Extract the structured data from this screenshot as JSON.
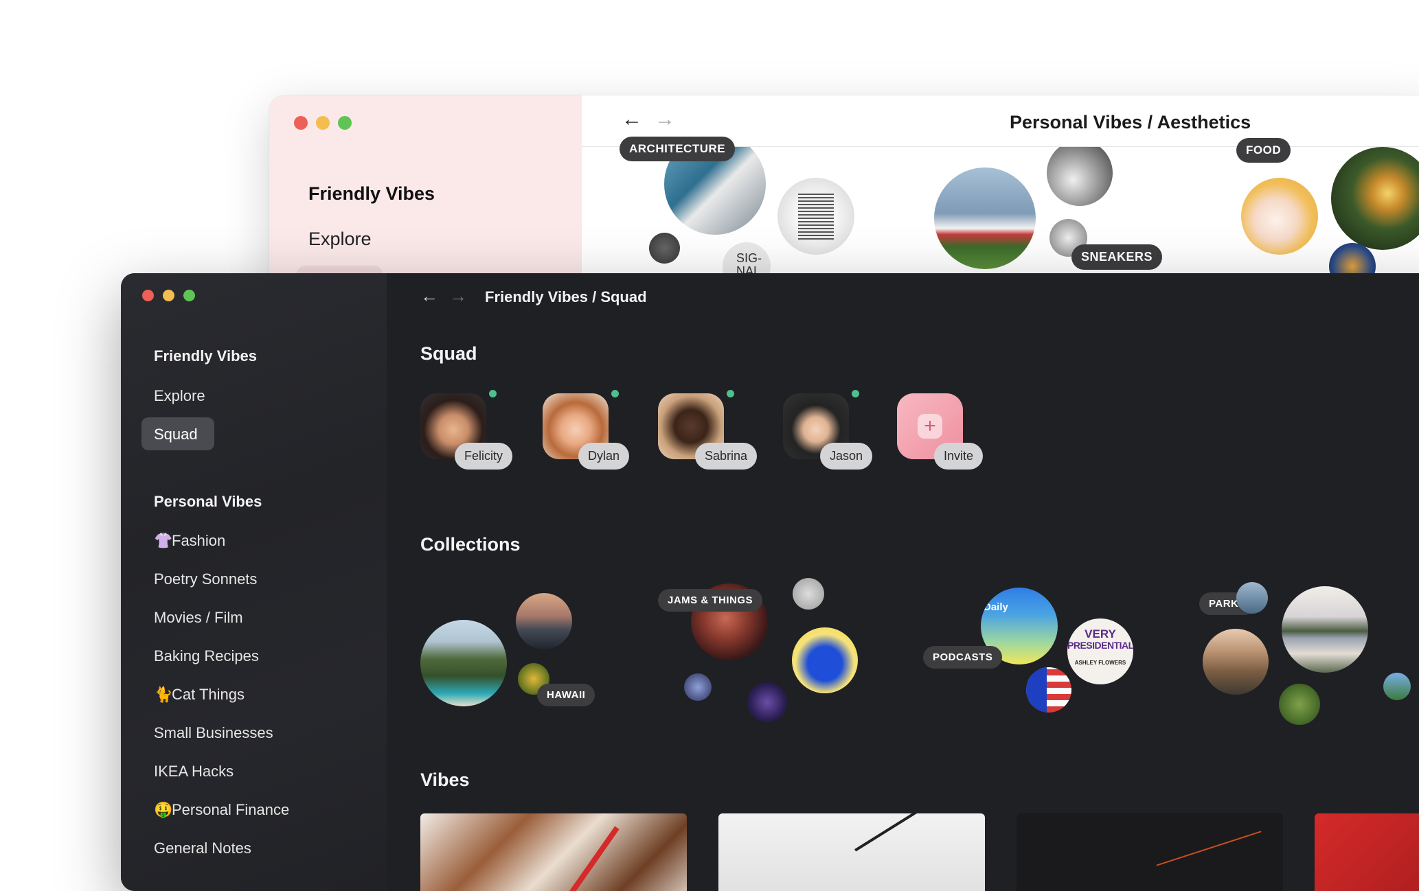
{
  "back_window": {
    "sidebar": {
      "heading": "Friendly Vibes",
      "item": "Explore"
    },
    "breadcrumb": "Personal Vibes / Aesthetics",
    "tags": {
      "architecture": "ARCHITECTURE",
      "food": "FOOD",
      "sneakers": "SNEAKERS",
      "signal": "SIG-\nNAL."
    }
  },
  "front_window": {
    "breadcrumb": "Friendly Vibes / Squad",
    "sidebar": {
      "friendly_vibes": {
        "heading": "Friendly Vibes",
        "items": [
          "Explore",
          "Squad"
        ]
      },
      "personal_vibes": {
        "heading": "Personal Vibes",
        "items": [
          {
            "emoji": "👚",
            "label": "Fashion"
          },
          {
            "emoji": "",
            "label": "Poetry Sonnets"
          },
          {
            "emoji": "",
            "label": "Movies / Film"
          },
          {
            "emoji": "",
            "label": "Baking Recipes"
          },
          {
            "emoji": "🐈",
            "label": "Cat Things"
          },
          {
            "emoji": "",
            "label": "Small Businesses"
          },
          {
            "emoji": "",
            "label": "IKEA Hacks"
          },
          {
            "emoji": "🤑",
            "label": "Personal Finance"
          },
          {
            "emoji": "",
            "label": "General Notes"
          }
        ]
      }
    },
    "squad": {
      "title": "Squad",
      "members": [
        "Felicity",
        "Dylan",
        "Sabrina",
        "Jason"
      ],
      "invite_label": "Invite"
    },
    "collections": {
      "title": "Collections",
      "tags": [
        "HAWAII",
        "JAMS & THINGS",
        "PODCASTS",
        "PARKS"
      ],
      "image_text": {
        "daily": "e\nDaily",
        "presidential_line1": "VERY",
        "presidential_line2": "PRESIDENTIAL",
        "presidential_line3": "ASHLEY FLOWERS"
      }
    },
    "vibes": {
      "title": "Vibes"
    }
  },
  "colors": {
    "dark_bg": "#1f2024",
    "sidebar_bg": "#25262b",
    "accent_online": "#4fc08d",
    "invite_pink": "#f4a8b3",
    "back_sidebar": "#fbe9ea"
  }
}
